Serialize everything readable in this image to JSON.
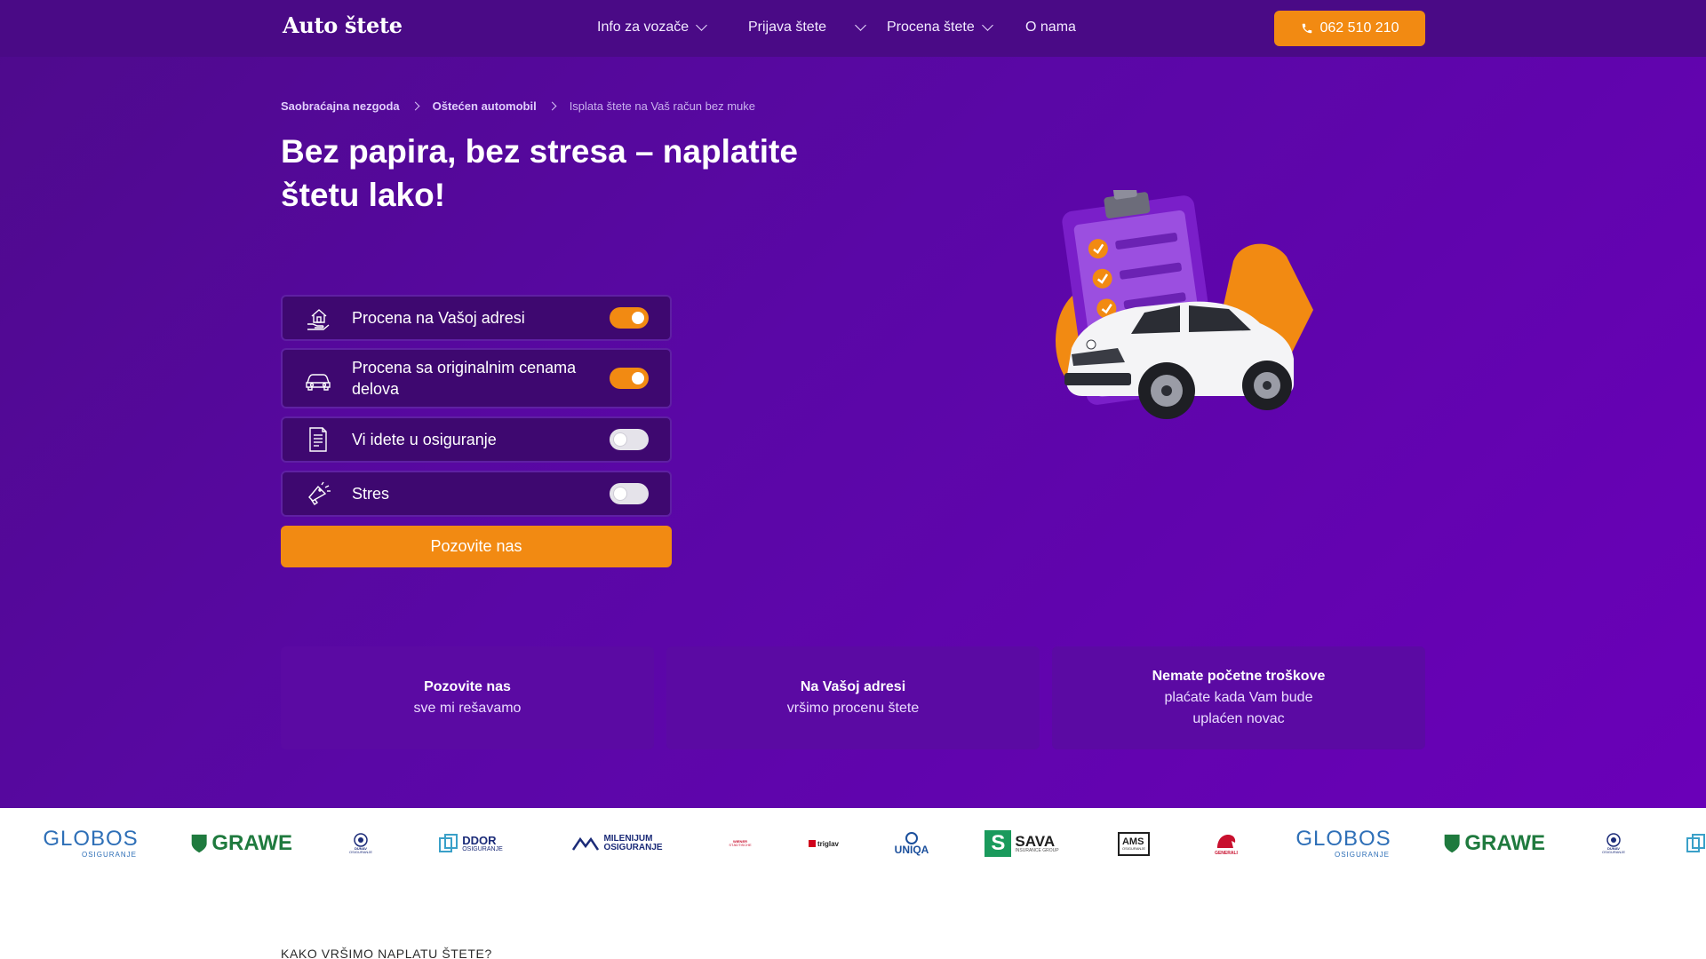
{
  "header": {
    "logo": "Auto štete",
    "nav": [
      {
        "label": "Info za vozače",
        "has_dropdown": true
      },
      {
        "label": "Prijava štete",
        "has_dropdown": true
      },
      {
        "label": "Procena štete",
        "has_dropdown": true
      },
      {
        "label": "O nama",
        "has_dropdown": false
      }
    ],
    "phone": "062 510 210"
  },
  "breadcrumb": [
    {
      "label": "Saobraćajna nezgoda",
      "link": true
    },
    {
      "label": "Oštećen automobil",
      "link": true
    },
    {
      "label": "Isplata štete na Vaš račun bez muke",
      "link": false
    }
  ],
  "hero": {
    "title": "Bez papira, bez stresa – naplatite štetu lako!",
    "features": [
      {
        "label": "Procena na Vašoj adresi",
        "icon": "house-hand-icon",
        "enabled": true
      },
      {
        "label": "Procena sa originalnim cenama delova",
        "icon": "car-icon",
        "enabled": true
      },
      {
        "label": "Vi idete u osiguranje",
        "icon": "document-icon",
        "enabled": false
      },
      {
        "label": "Stres",
        "icon": "megaphone-icon",
        "enabled": false
      }
    ],
    "cta": "Pozovite nas"
  },
  "steps": [
    {
      "title": "Pozovite nas",
      "subtitle": "sve mi rešavamo"
    },
    {
      "title": "Na Vašoj adresi",
      "subtitle": "vršimo procenu štete"
    },
    {
      "title": "Nemate početne troškove",
      "subtitle": "plaćate kada Vam bude uplaćen novac"
    }
  ],
  "insurers": [
    {
      "name": "GLOBOS",
      "sub": "OSIGURANJE"
    },
    {
      "name": "GRAWE",
      "sub": ""
    },
    {
      "name": "DUNAV",
      "sub": "OSIGURANJE"
    },
    {
      "name": "DDOR",
      "sub": "OSIGURANJE"
    },
    {
      "name": "MILENIJUM",
      "sub": "OSIGURANJE"
    },
    {
      "name": "WIENER",
      "sub": "STÄDTISCHE"
    },
    {
      "name": "triglav",
      "sub": ""
    },
    {
      "name": "UNIQA",
      "sub": ""
    },
    {
      "name": "SAVA",
      "sub": "INSURANCE GROUP"
    },
    {
      "name": "AMS",
      "sub": "OSIGURANJE"
    },
    {
      "name": "GENERALI",
      "sub": ""
    },
    {
      "name": "GLOBOS",
      "sub": "OSIGURANJE"
    },
    {
      "name": "GRAWE",
      "sub": ""
    },
    {
      "name": "DUNAV",
      "sub": "OSIGURANJE"
    }
  ],
  "section": {
    "label": "KAKO VRŠIMO NAPLATU ŠTETE?"
  },
  "colors": {
    "primary": "#5a07a6",
    "accent": "#f28a12",
    "header": "#4a0a86"
  }
}
